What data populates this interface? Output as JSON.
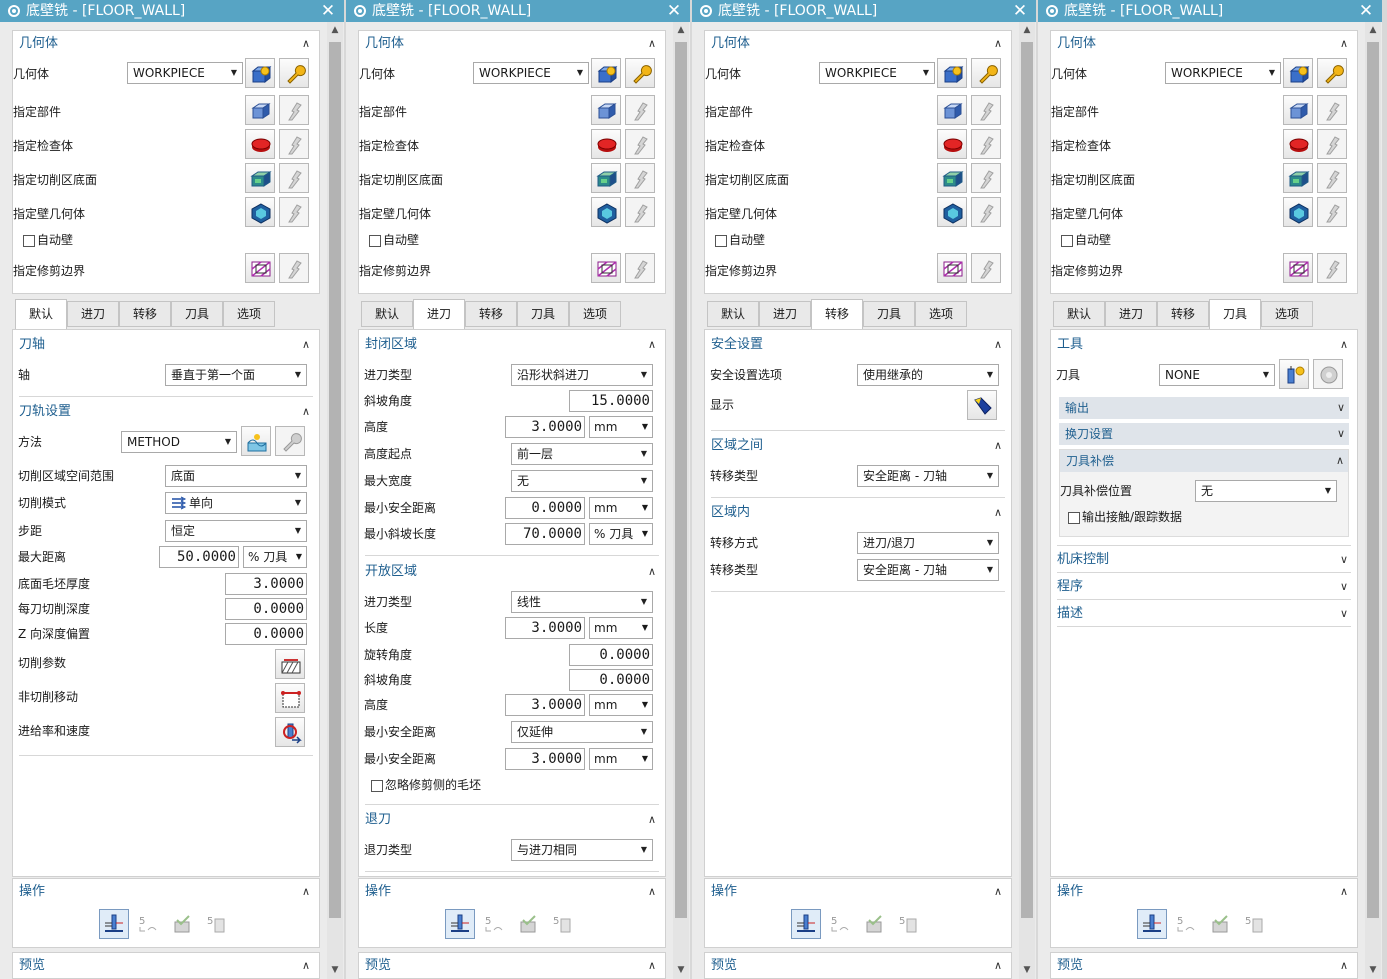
{
  "window": {
    "title": "底壁铣 - [FLOOR_WALL]"
  },
  "geometry": {
    "header": "几何体",
    "geometry_label": "几何体",
    "geometry_value": "WORKPIECE",
    "specify_part": "指定部件",
    "specify_check": "指定检查体",
    "specify_floor": "指定切削区底面",
    "specify_wall": "指定壁几何体",
    "auto_wall": "自动壁",
    "specify_trim": "指定修剪边界"
  },
  "tabs": [
    "默认",
    "进刀",
    "转移",
    "刀具",
    "选项"
  ],
  "panel1": {
    "tool_axis": {
      "header": "刀轴",
      "axis_label": "轴",
      "axis_value": "垂直于第一个面"
    },
    "path": {
      "header": "刀轨设置",
      "method_label": "方法",
      "method_value": "METHOD",
      "cut_area_label": "切削区域空间范围",
      "cut_area_value": "底面",
      "cut_mode_label": "切削模式",
      "cut_mode_value": "单向",
      "step_label": "步距",
      "step_value": "恒定",
      "max_dist_label": "最大距离",
      "max_dist_value": "50.0000",
      "max_dist_unit": "% 刀具",
      "floor_stock_label": "底面毛坯厚度",
      "floor_stock_value": "3.0000",
      "depth_per_cut_label": "每刀切削深度",
      "depth_per_cut_value": "0.0000",
      "z_offset_label": "Z 向深度偏置",
      "z_offset_value": "0.0000",
      "cut_params": "切削参数",
      "non_cut": "非切削移动",
      "feeds": "进给率和速度"
    }
  },
  "panel2": {
    "closed": {
      "header": "封闭区域",
      "type_label": "进刀类型",
      "type_value": "沿形状斜进刀",
      "ramp_label": "斜坡角度",
      "ramp_value": "15.0000",
      "height_label": "高度",
      "height_value": "3.0000",
      "height_unit": "mm",
      "start_label": "高度起点",
      "start_value": "前一层",
      "max_width_label": "最大宽度",
      "max_width_value": "无",
      "min_safe_label": "最小安全距离",
      "min_safe_value": "0.0000",
      "min_safe_unit": "mm",
      "min_ramp_label": "最小斜坡长度",
      "min_ramp_value": "70.0000",
      "min_ramp_unit": "% 刀具"
    },
    "open": {
      "header": "开放区域",
      "type_label": "进刀类型",
      "type_value": "线性",
      "length_label": "长度",
      "length_value": "3.0000",
      "length_unit": "mm",
      "rot_label": "旋转角度",
      "rot_value": "0.0000",
      "ramp_label": "斜坡角度",
      "ramp_value": "0.0000",
      "height_label": "高度",
      "height_value": "3.0000",
      "height_unit": "mm",
      "min_safe_label": "最小安全距离",
      "min_safe_value": "仅延伸",
      "min_safe2_label": "最小安全距离",
      "min_safe2_value": "3.0000",
      "min_safe2_unit": "mm",
      "ignore_label": "忽略修剪侧的毛坯"
    },
    "retract": {
      "header": "退刀",
      "type_label": "退刀类型",
      "type_value": "与进刀相同"
    }
  },
  "panel3": {
    "safety": {
      "header": "安全设置",
      "option_label": "安全设置选项",
      "option_value": "使用继承的",
      "display_label": "显示"
    },
    "between": {
      "header": "区域之间",
      "type_label": "转移类型",
      "type_value": "安全距离 - 刀轴"
    },
    "within": {
      "header": "区域内",
      "method_label": "转移方式",
      "method_value": "进刀/退刀",
      "type_label": "转移类型",
      "type_value": "安全距离 - 刀轴"
    }
  },
  "panel4": {
    "tool": {
      "header": "工具",
      "tool_label": "刀具",
      "tool_value": "NONE",
      "output": "输出",
      "change": "换刀设置",
      "comp": "刀具补偿",
      "comp_pos_label": "刀具补偿位置",
      "comp_pos_value": "无",
      "output_contact": "输出接触/跟踪数据"
    },
    "machine": "机床控制",
    "program": "程序",
    "desc": "描述"
  },
  "bottom": {
    "actions": "操作",
    "preview": "预览"
  },
  "colors": {
    "title_bar": "#57a4c4",
    "header_text": "#1f5f8f",
    "check_body": "#d01818"
  }
}
